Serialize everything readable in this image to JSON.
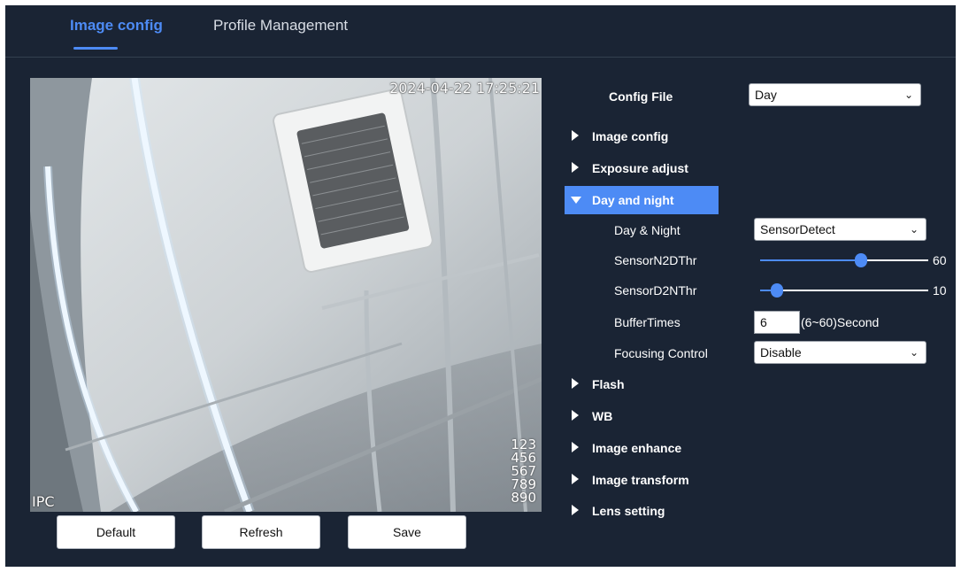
{
  "tabs": [
    {
      "label": "Image config",
      "active": true
    },
    {
      "label": "Profile Management",
      "active": false
    }
  ],
  "preview": {
    "timestamp": "2024-04-22 17:25:21",
    "channel_name": "IPC",
    "osd_lines": [
      "123",
      "456",
      "567",
      "789",
      "890"
    ]
  },
  "buttons": {
    "default_label": "Default",
    "refresh_label": "Refresh",
    "save_label": "Save"
  },
  "config_file": {
    "label": "Config File",
    "value": "Day"
  },
  "sections": [
    {
      "label": "Image config",
      "expanded": false
    },
    {
      "label": "Exposure adjust",
      "expanded": false
    },
    {
      "label": "Day and night",
      "expanded": true
    },
    {
      "label": "Flash",
      "expanded": false
    },
    {
      "label": "WB",
      "expanded": false
    },
    {
      "label": "Image enhance",
      "expanded": false
    },
    {
      "label": "Image transform",
      "expanded": false
    },
    {
      "label": "Lens setting",
      "expanded": false
    }
  ],
  "day_night": {
    "mode_label": "Day & Night",
    "mode_value": "SensorDetect",
    "n2d_label": "SensorN2DThr",
    "n2d_value": "60",
    "d2n_label": "SensorD2NThr",
    "d2n_value": "10",
    "buffer_label": "BufferTimes",
    "buffer_value": "6",
    "buffer_hint": "(6~60)Second",
    "focus_label": "Focusing Control",
    "focus_value": "Disable"
  },
  "slider_levels": {
    "n2d_fraction": 0.6,
    "d2n_fraction": 0.1
  },
  "colors": {
    "background": "#1a2434",
    "accent": "#4d8bf5"
  }
}
